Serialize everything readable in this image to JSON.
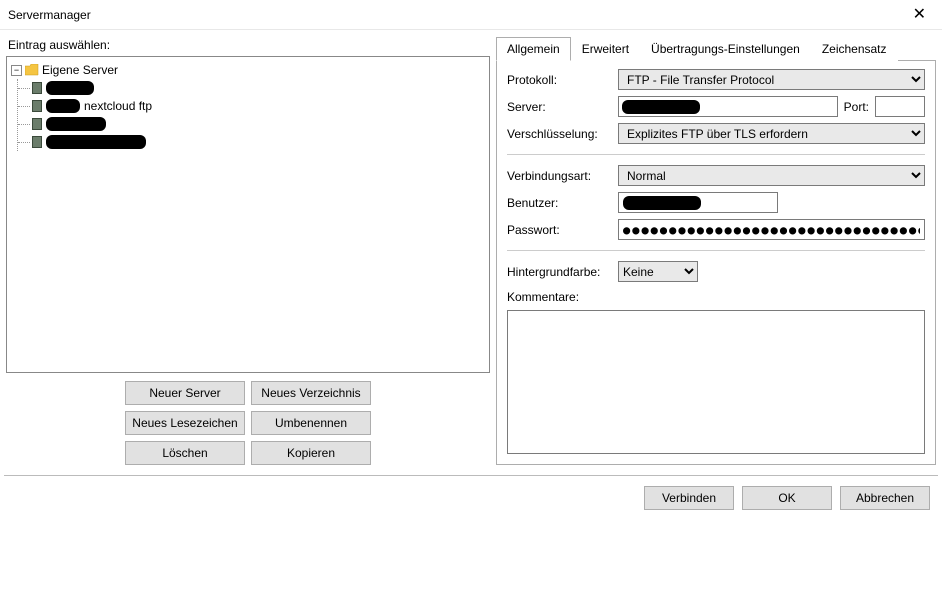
{
  "window": {
    "title": "Servermanager"
  },
  "left": {
    "label": "Eintrag auswählen:",
    "root_label": "Eigene Server",
    "items": [
      {
        "label": ""
      },
      {
        "label": "nextcloud ftp"
      },
      {
        "label": ""
      },
      {
        "label": ""
      }
    ],
    "buttons": {
      "new_server": "Neuer Server",
      "new_dir": "Neues Verzeichnis",
      "new_bookmark": "Neues Lesezeichen",
      "rename": "Umbenennen",
      "delete": "Löschen",
      "copy": "Kopieren"
    }
  },
  "tabs": {
    "general": "Allgemein",
    "advanced": "Erweitert",
    "transfer": "Übertragungs-Einstellungen",
    "charset": "Zeichensatz"
  },
  "form": {
    "protocol_label": "Protokoll:",
    "protocol_value": "FTP - File Transfer Protocol",
    "server_label": "Server:",
    "server_value": "",
    "port_label": "Port:",
    "port_value": "",
    "encryption_label": "Verschlüsselung:",
    "encryption_value": "Explizites FTP über TLS erfordern",
    "conntype_label": "Verbindungsart:",
    "conntype_value": "Normal",
    "user_label": "Benutzer:",
    "user_value": "",
    "pass_label": "Passwort:",
    "pass_value": "●●●●●●●●●●●●●●●●●●●●●●●●●●●●●●●●●●●●●●●●●●●●",
    "bgcolor_label": "Hintergrundfarbe:",
    "bgcolor_value": "Keine",
    "comments_label": "Kommentare:",
    "comments_value": ""
  },
  "footer": {
    "connect": "Verbinden",
    "ok": "OK",
    "cancel": "Abbrechen"
  }
}
